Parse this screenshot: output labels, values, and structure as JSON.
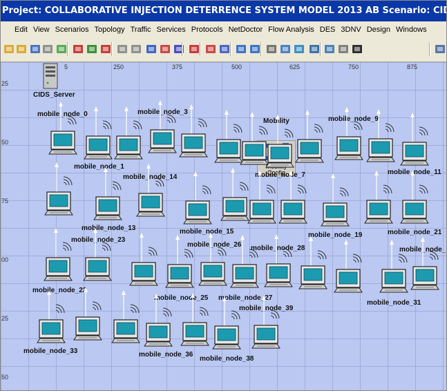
{
  "window": {
    "title": "Project: COLLABORATIVE INJECTION DETERRENCE SYSTEM MODEL 2013 AB Scenario: CIDS RESPONSE   [S"
  },
  "menu": {
    "items": [
      "Edit",
      "View",
      "Scenarios",
      "Topology",
      "Traffic",
      "Services",
      "Protocols",
      "NetDoctor",
      "Flow Analysis",
      "DES",
      "3DNV",
      "Design",
      "Windows"
    ]
  },
  "toolbar": {
    "icons": [
      "open-folder",
      "open",
      "save",
      "print",
      "object-palette",
      "red-node",
      "green-node",
      "failure",
      "zoom-in",
      "zoom-out",
      "ace",
      "cfg",
      "vne",
      "bar-chart",
      "red-node-2",
      "triangle",
      "grid-a",
      "grid-b",
      "scissors",
      "route",
      "water",
      "flag",
      "bar-3d",
      "chart",
      "info",
      "ipv6"
    ]
  },
  "ruler": {
    "x": [
      "5",
      "250",
      "375",
      "500",
      "625",
      "750",
      "875"
    ],
    "y": [
      "25",
      "50",
      "75",
      "00",
      "25",
      "50"
    ]
  },
  "server": {
    "label": "CIDS_Server"
  },
  "mobility": {
    "title": "Mobility Config",
    "line1": "Mobility",
    "line2": "Config",
    "label": "Mobility"
  },
  "nodes": [
    {
      "label": "mobile_node_0"
    },
    {
      "label": "mobile_node_3"
    },
    {
      "label": "mobile_node_9"
    },
    {
      "label": "mobile_node_1"
    },
    {
      "label": "mobile_node_14"
    },
    {
      "label": "mobile_node_7"
    },
    {
      "label": "mobile_node_11"
    },
    {
      "label": "mobile_node_13"
    },
    {
      "label": "mobile_node_23"
    },
    {
      "label": "mobile_node_15"
    },
    {
      "label": "mobile_node_19"
    },
    {
      "label": "mobile_node_21"
    },
    {
      "label": "mobile_node_26"
    },
    {
      "label": "mobile_node_28"
    },
    {
      "label": "mobile_node_"
    },
    {
      "label": "mobile_node_22"
    },
    {
      "label": "mobile_node_25"
    },
    {
      "label": "mobile_node_27"
    },
    {
      "label": "mobile_node_39"
    },
    {
      "label": "mobile_node_31"
    },
    {
      "label": "mobile_node_33"
    },
    {
      "label": "mobile_node_36"
    },
    {
      "label": "mobile_node_38"
    }
  ]
}
